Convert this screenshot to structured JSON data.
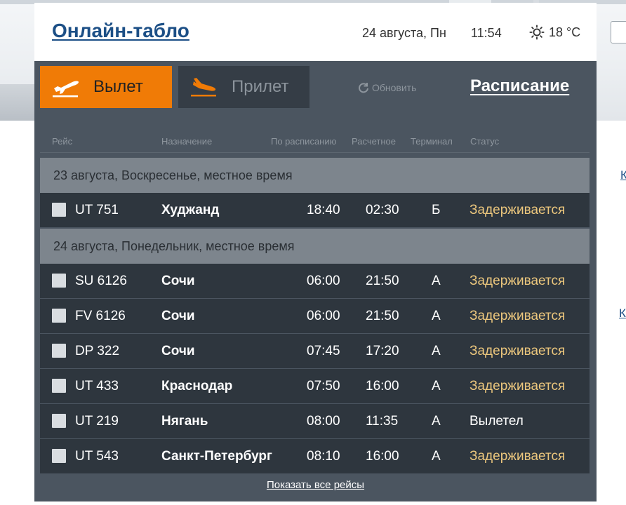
{
  "header": {
    "title": "Онлайн-табло",
    "date": "24 августа, Пн",
    "time": "11:54",
    "temperature": "18 °C",
    "weather_icon": "sun-icon"
  },
  "side_links": [
    "К",
    "К"
  ],
  "tabs": {
    "departure": "Вылет",
    "arrival": "Прилет"
  },
  "refresh_label": "Обновить",
  "schedule_label": "Расписание",
  "columns": {
    "flight": "Рейс",
    "destination": "Назначение",
    "scheduled": "По расписанию",
    "estimated": "Расчетное",
    "terminal": "Терминал",
    "status": "Статус"
  },
  "days": [
    {
      "label": "23 августа, Воскресенье, местное время",
      "flights": [
        {
          "airline_icon": "utair-logo-icon",
          "number": "UT 751",
          "destination": "Худжанд",
          "scheduled": "18:40",
          "estimated": "02:30",
          "terminal": "Б",
          "status": "Задерживается",
          "status_kind": "delay"
        }
      ]
    },
    {
      "label": "24 августа, Понедельник, местное время",
      "flights": [
        {
          "airline_icon": "aeroflot-logo-icon",
          "number": "SU 6126",
          "destination": "Сочи",
          "scheduled": "06:00",
          "estimated": "21:50",
          "terminal": "А",
          "status": "Задерживается",
          "status_kind": "delay"
        },
        {
          "airline_icon": "rossiya-logo-icon",
          "number": "FV 6126",
          "destination": "Сочи",
          "scheduled": "06:00",
          "estimated": "21:50",
          "terminal": "А",
          "status": "Задерживается",
          "status_kind": "delay"
        },
        {
          "airline_icon": "pobeda-logo-icon",
          "number": "DP 322",
          "destination": "Сочи",
          "scheduled": "07:45",
          "estimated": "17:20",
          "terminal": "А",
          "status": "Задерживается",
          "status_kind": "delay"
        },
        {
          "airline_icon": "utair-logo-icon",
          "number": "UT 433",
          "destination": "Краснодар",
          "scheduled": "07:50",
          "estimated": "16:00",
          "terminal": "А",
          "status": "Задерживается",
          "status_kind": "delay"
        },
        {
          "airline_icon": "utair-logo-icon",
          "number": "UT 219",
          "destination": "Нягань",
          "scheduled": "08:00",
          "estimated": "11:35",
          "terminal": "А",
          "status": "Вылетел",
          "status_kind": "departed"
        },
        {
          "airline_icon": "utair-logo-icon",
          "number": "UT 543",
          "destination": "Санкт-Петербург",
          "scheduled": "08:10",
          "estimated": "16:00",
          "terminal": "А",
          "status": "Задерживается",
          "status_kind": "delay"
        }
      ]
    }
  ],
  "show_all_label": "Показать все рейсы",
  "colors": {
    "accent": "#f07b06",
    "board_bg": "#4b5560",
    "row_bg": "#2e363e",
    "day_bg": "#7d858d",
    "status_delay": "#ecc77d",
    "link": "#1c4f86"
  }
}
